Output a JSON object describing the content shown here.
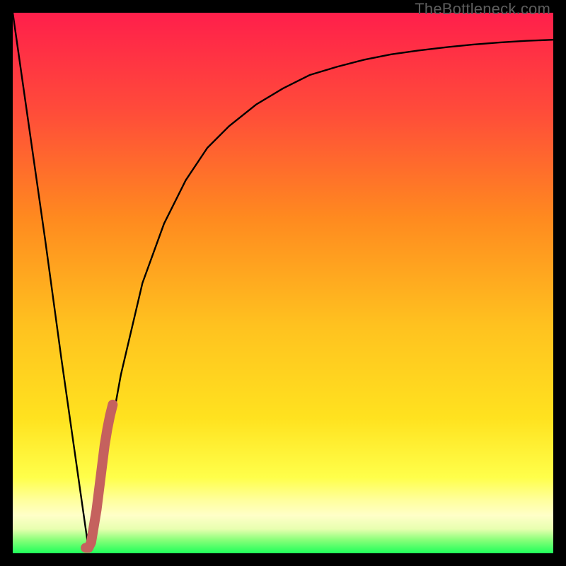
{
  "watermark": "TheBottleneck.com",
  "colors": {
    "frame": "#000000",
    "gradient_top": "#ff1f4b",
    "gradient_mid1": "#ff8a1f",
    "gradient_mid2": "#ffe21f",
    "gradient_band": "#ffff8a",
    "gradient_bottom": "#1fff5a",
    "curve": "#000000",
    "highlight": "#c5615e"
  },
  "chart_data": {
    "type": "line",
    "title": "",
    "xlabel": "",
    "ylabel": "",
    "xlim": [
      0,
      100
    ],
    "ylim": [
      0,
      100
    ],
    "grid": false,
    "legend": false,
    "series": [
      {
        "name": "bottleneck-curve",
        "x": [
          0,
          3,
          6,
          9,
          12,
          14,
          16,
          18,
          20,
          24,
          28,
          32,
          36,
          40,
          45,
          50,
          55,
          60,
          65,
          70,
          75,
          80,
          85,
          90,
          95,
          100
        ],
        "y": [
          100,
          79,
          58,
          36,
          15,
          1,
          10,
          22,
          33,
          50,
          61,
          69,
          75,
          79,
          83,
          86,
          88.5,
          90,
          91.3,
          92.3,
          93,
          93.6,
          94.1,
          94.5,
          94.8,
          95
        ]
      },
      {
        "name": "highlight-segment",
        "x": [
          13.5,
          14.0,
          14.5,
          15.0,
          15.5,
          16.0,
          16.5,
          17.0,
          17.5,
          18.0,
          18.5
        ],
        "y": [
          1.0,
          1.0,
          2.0,
          5.0,
          8.0,
          12.0,
          16.0,
          20.0,
          23.0,
          25.5,
          27.5
        ]
      }
    ],
    "annotations": []
  }
}
